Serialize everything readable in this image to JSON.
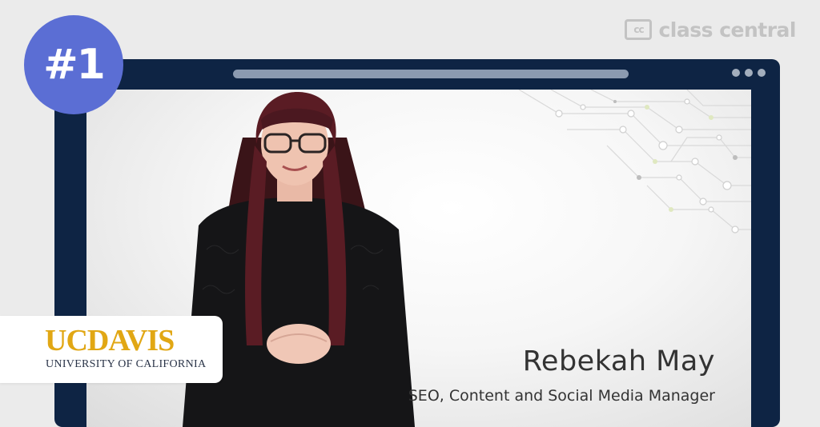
{
  "brand": {
    "icon_text": "cc",
    "name": "class central"
  },
  "badge": {
    "rank": "#1"
  },
  "video": {
    "speaker_name": "Rebekah May",
    "speaker_role": "SEO, Content and Social Media Manager"
  },
  "university": {
    "logo_main": "UCDAVIS",
    "logo_sub": "UNIVERSITY OF CALIFORNIA"
  },
  "colors": {
    "badge": "#5b6ed4",
    "window_frame": "#0e2444",
    "logo_gold": "#e1a714",
    "logo_navy": "#2a3448"
  },
  "icons": [
    "class-central-logo-icon",
    "window-menu-dots-icon"
  ]
}
